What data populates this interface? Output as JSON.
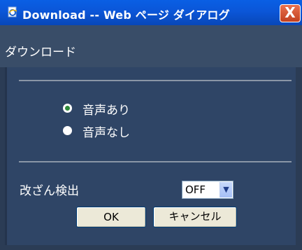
{
  "window": {
    "title": "Download -- Web ページ ダイアログ",
    "close_glyph": "X"
  },
  "header": {
    "title": "ダウンロード"
  },
  "audio_options": [
    {
      "label": "音声あり",
      "selected": true
    },
    {
      "label": "音声なし",
      "selected": false
    }
  ],
  "tamper_detection": {
    "label": "改ざん検出",
    "value": "OFF"
  },
  "buttons": {
    "ok": "OK",
    "cancel": "キャンセル"
  },
  "colors": {
    "titlebar": "#0a5fe4",
    "background": "#2f4566",
    "header": "#394d68",
    "close": "#d55a35"
  }
}
